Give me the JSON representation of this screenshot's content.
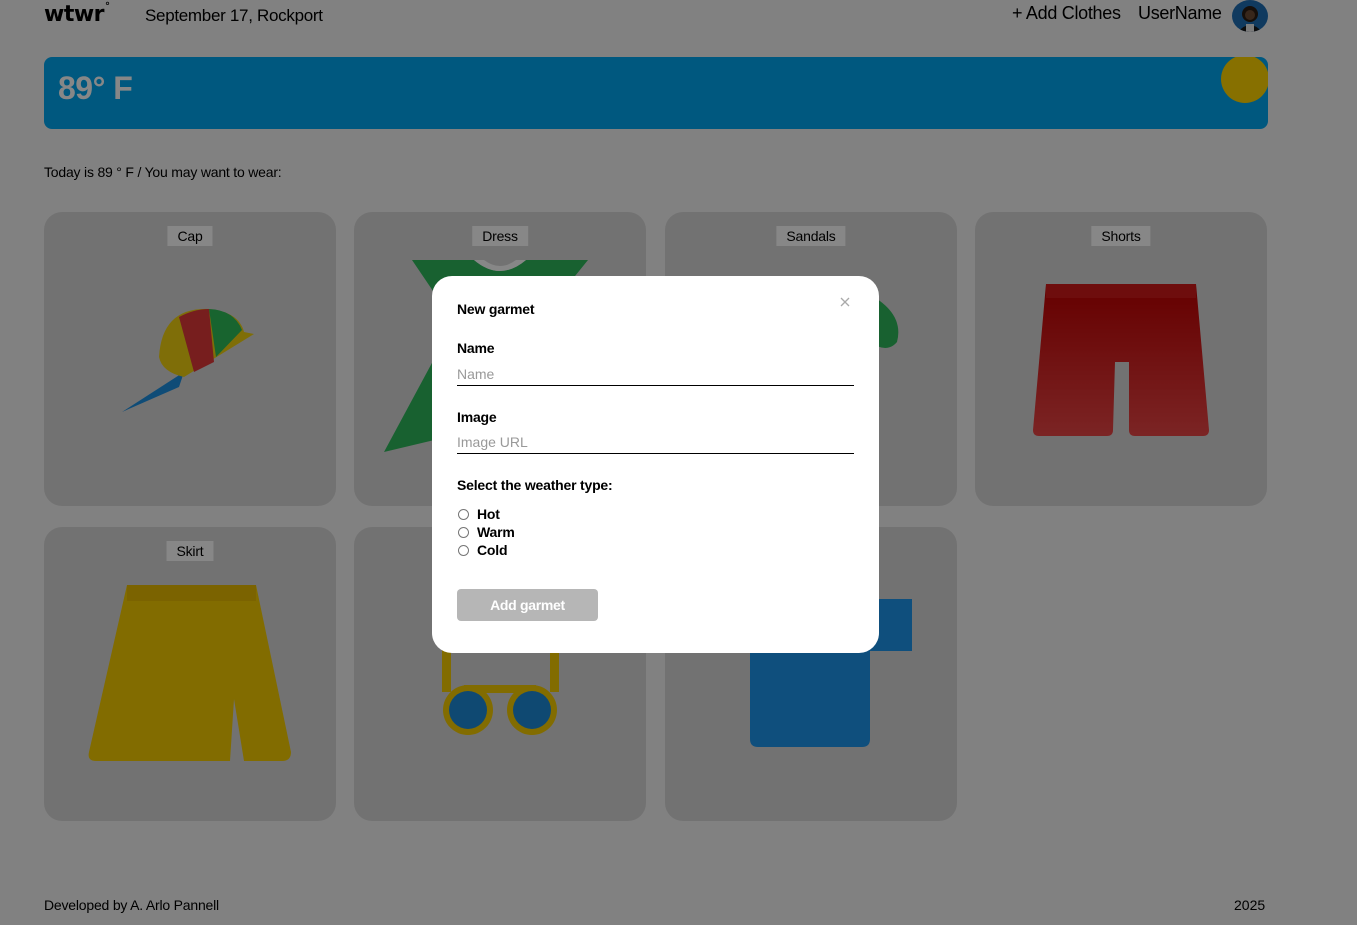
{
  "header": {
    "logo": "wtwr",
    "logo_mark": "°",
    "date_location": "September 17, Rockport",
    "add_clothes_label": "+ Add Clothes",
    "username": "UserName",
    "avatar_icon": "user-avatar"
  },
  "weather": {
    "temperature": "89° F",
    "sun_icon": "sun-icon",
    "background_color": "#00a6f0",
    "sun_color": "#ffd400"
  },
  "main": {
    "today_text": "Today is 89 ° F / You may want to wear:",
    "cards": [
      {
        "label": "Cap",
        "icon": "cap-icon"
      },
      {
        "label": "Dress",
        "icon": "dress-icon"
      },
      {
        "label": "Sandals",
        "icon": "sandals-icon"
      },
      {
        "label": "Shorts",
        "icon": "shorts-icon"
      },
      {
        "label": "Skirt",
        "icon": "skirt-icon"
      },
      {
        "label": "",
        "icon": "sunglasses-icon"
      },
      {
        "label": "",
        "icon": "shirt-icon"
      }
    ]
  },
  "footer": {
    "credit": "Developed by A. Arlo Pannell",
    "year": "2025"
  },
  "modal": {
    "title": "New garmet",
    "close_icon": "close-icon",
    "name_label": "Name",
    "name_placeholder": "Name",
    "name_value": "",
    "image_label": "Image",
    "image_placeholder": "Image URL",
    "image_value": "",
    "weather_type_label": "Select the weather type:",
    "weather_options": [
      "Hot",
      "Warm",
      "Cold"
    ],
    "selected_weather": "",
    "submit_label": "Add garmet"
  }
}
